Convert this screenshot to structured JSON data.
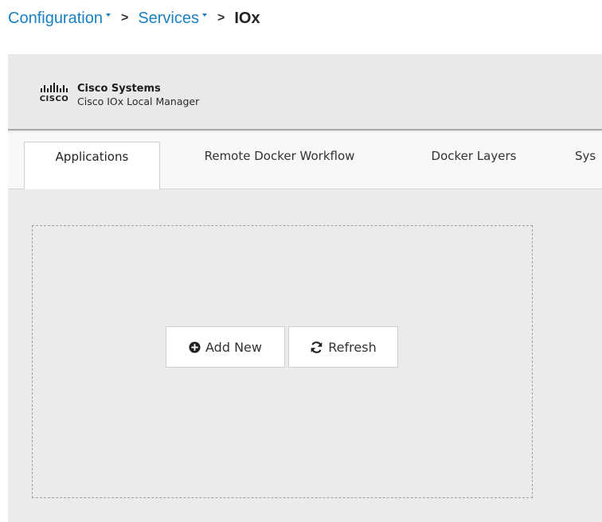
{
  "breadcrumb": {
    "items": [
      {
        "label": "Configuration",
        "dropdown": true
      },
      {
        "label": "Services",
        "dropdown": true
      },
      {
        "label": "IOx",
        "dropdown": false
      }
    ],
    "separator": ">"
  },
  "header": {
    "logo_word": "CISCO",
    "company": "Cisco Systems",
    "product": "Cisco IOx Local Manager"
  },
  "tabs": [
    {
      "label": "Applications",
      "active": true
    },
    {
      "label": "Remote Docker Workflow",
      "active": false
    },
    {
      "label": "Docker Layers",
      "active": false
    },
    {
      "label": "Sys",
      "active": false
    }
  ],
  "actions": {
    "add_new": {
      "label": "Add New",
      "icon": "plus-circle-icon"
    },
    "refresh": {
      "label": "Refresh",
      "icon": "refresh-icon"
    }
  },
  "colors": {
    "link": "#1a7fc1",
    "header_bg": "#e9e9e9",
    "content_bg": "#ebebeb"
  }
}
